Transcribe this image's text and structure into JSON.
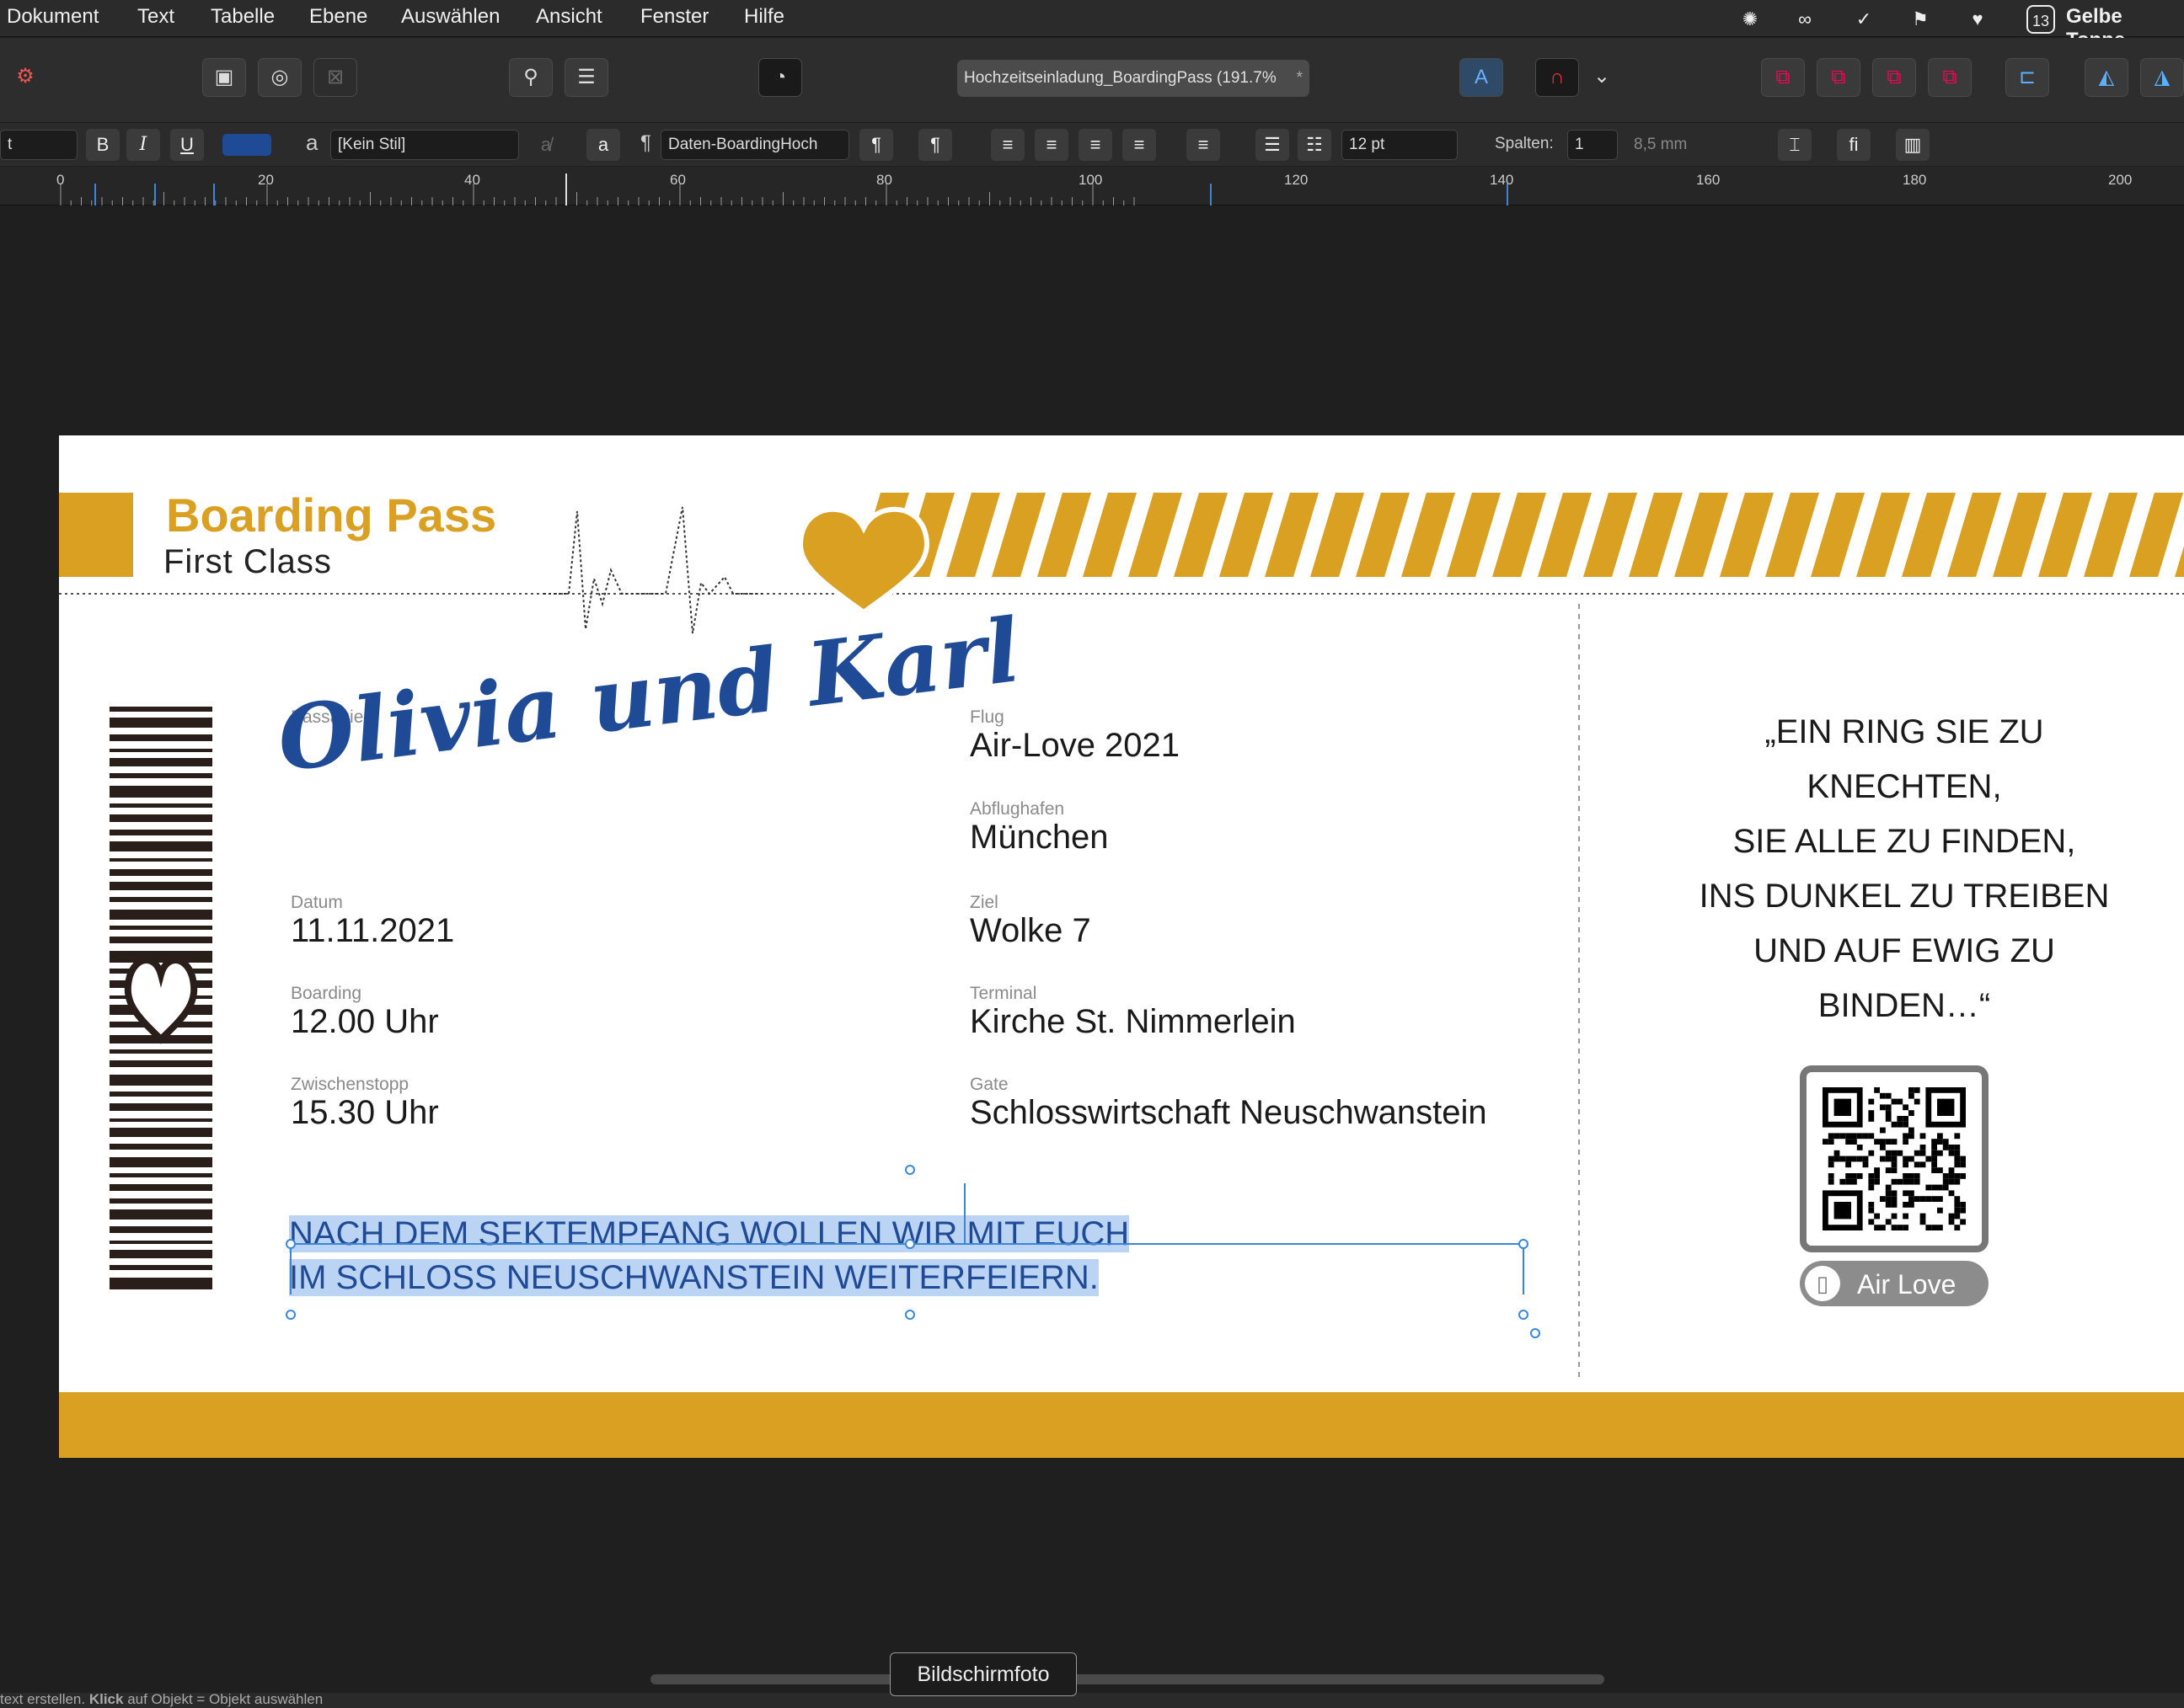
{
  "menubar": {
    "items": [
      "Dokument",
      "Text",
      "Tabelle",
      "Ebene",
      "Auswählen",
      "Ansicht",
      "Fenster",
      "Hilfe"
    ],
    "right_title": "Gelbe Tonne",
    "calendar_day": "13"
  },
  "toolbar": {
    "document_tab": "Hochzeitseinladung_BoardingPass (191.7%",
    "tab_modified_mark": "*"
  },
  "context_bar": {
    "bold": "B",
    "italic": "I",
    "underline": "U",
    "text_color": "#1f4a96",
    "char_style_icon": "a",
    "char_style": "[Kein Stil]",
    "para_style_icon": "¶",
    "para_style": "Daten-BoardingHoch",
    "font_size": "12 pt",
    "columns_label": "Spalten:",
    "columns_value": "1",
    "gutter_value": "8,5 mm",
    "ligature_label": "fi"
  },
  "ruler": {
    "labels": [
      "0",
      "20",
      "40",
      "60",
      "80",
      "100",
      "120",
      "140",
      "160",
      "180",
      "200"
    ]
  },
  "ticket": {
    "title": "Boarding Pass",
    "subtitle": "First Class",
    "accent_color": "#d9a021",
    "fields_left": [
      {
        "label": "Passagiere",
        "value": "Olivia und Karl"
      },
      {
        "label": "Datum",
        "value": "11.11.2021"
      },
      {
        "label": "Boarding",
        "value": "12.00 Uhr"
      },
      {
        "label": "Zwischenstopp",
        "value": "15.30 Uhr"
      }
    ],
    "fields_right": [
      {
        "label": "Flug",
        "value": "Air-Love 2021"
      },
      {
        "label": "Abflughafen",
        "value": "München"
      },
      {
        "label": "Ziel",
        "value": "Wolke 7"
      },
      {
        "label": "Terminal",
        "value": "Kirche St. Nimmerlein"
      },
      {
        "label": "Gate",
        "value": "Schlosswirtschaft Neuschwanstein"
      }
    ],
    "note_line1": "NACH DEM SEKTEMPFANG WOLLEN WIR MIT EUCH",
    "note_line2": "IM SCHLOSS NEUSCHWANSTEIN WEITERFEIERN.",
    "quote_lines": [
      "„EIN RING SIE ZU",
      "KNECHTEN,",
      "SIE ALLE ZU FINDEN,",
      "INS DUNKEL ZU TREIBEN",
      "UND AUF EWIG ZU",
      "BINDEN…“"
    ],
    "qr_caption": "Air Love"
  },
  "statusbar": {
    "tooltip": "Bildschirmfoto",
    "hint_prefix": "text erstellen. ",
    "hint_bold": "Klick",
    "hint_suffix": " auf Objekt = Objekt auswählen"
  }
}
